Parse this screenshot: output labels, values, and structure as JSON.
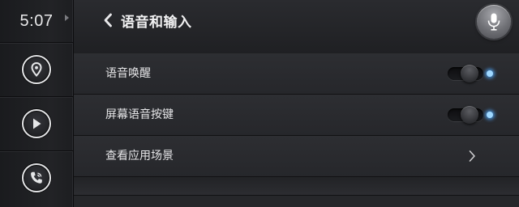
{
  "status": {
    "time": "5:07"
  },
  "sidebar": {
    "items": [
      {
        "icon": "location-pin-icon"
      },
      {
        "icon": "play-icon"
      },
      {
        "icon": "phone-icon"
      }
    ]
  },
  "header": {
    "title": "语音和输入",
    "back_icon": "chevron-left-icon",
    "mic_icon": "microphone-icon"
  },
  "settings": {
    "items": [
      {
        "label": "语音唤醒",
        "control": "toggle",
        "state": "on"
      },
      {
        "label": "屏幕语音按键",
        "control": "toggle",
        "state": "on"
      },
      {
        "label": "查看应用场景",
        "control": "chevron"
      }
    ]
  },
  "colors": {
    "indicator": "#4fa8ff",
    "text": "#e6e6e8",
    "background": "#1c1d20"
  }
}
